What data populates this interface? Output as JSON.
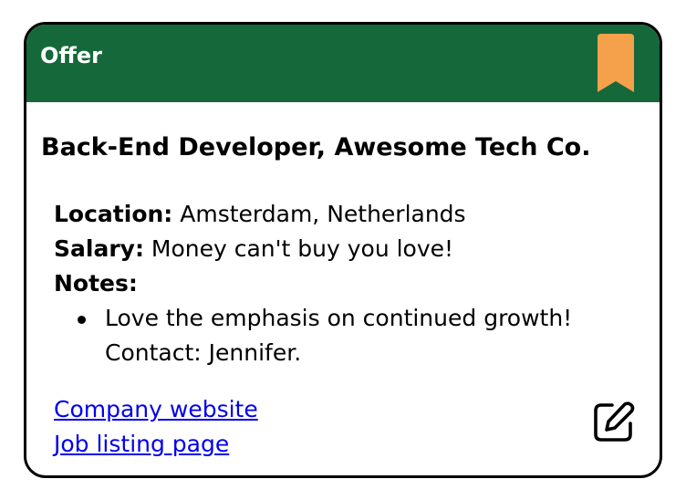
{
  "card": {
    "status": "Offer",
    "title": "Back-End Developer, Awesome Tech Co.",
    "location_label": "Location:",
    "location_value": "Amsterdam, Netherlands",
    "salary_label": "Salary:",
    "salary_value": "Money can't buy you love!",
    "notes_label": "Notes:",
    "notes": [
      "Love the emphasis on continued growth! Contact: Jennifer."
    ],
    "links": {
      "company_website": "Company website",
      "job_listing": "Job listing page"
    }
  },
  "colors": {
    "header_bg": "#15683a",
    "bookmark": "#f5a04b",
    "link": "#0000ee",
    "border": "#000000"
  },
  "icons": {
    "bookmark": "bookmark-icon",
    "edit": "edit-icon"
  }
}
